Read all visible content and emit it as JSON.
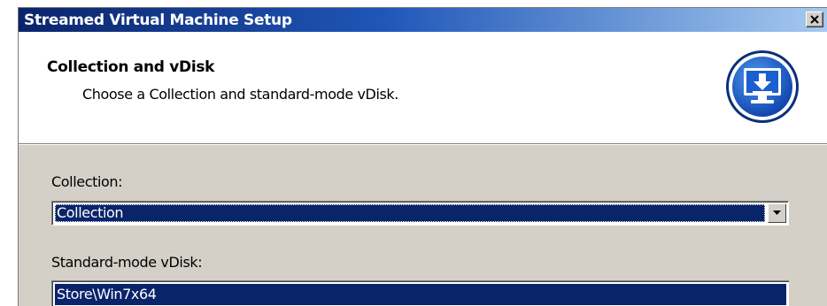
{
  "window": {
    "title": "Streamed Virtual Machine Setup",
    "close_label": "close"
  },
  "header": {
    "heading": "Collection and vDisk",
    "subheading": "Choose a Collection and standard-mode vDisk.",
    "icon": "monitor-download-icon"
  },
  "collection": {
    "label": "Collection:",
    "selected": "Collection"
  },
  "vdisk": {
    "label": "Standard-mode vDisk:",
    "items": [
      "Store\\Win7x64"
    ]
  },
  "colors": {
    "titlebar_start": "#0a246a",
    "titlebar_end": "#a6caf0",
    "selection": "#0a246a",
    "dialog_bg": "#d4d0c8",
    "logo_blue": "#1a5fd0"
  }
}
